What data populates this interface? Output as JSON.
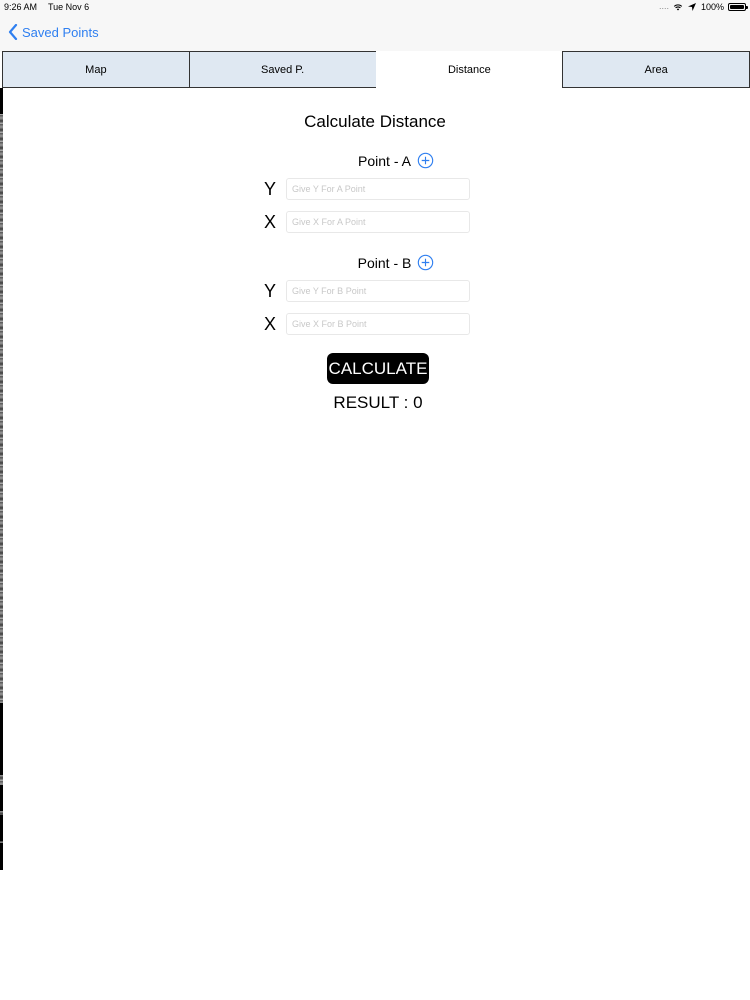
{
  "status_bar": {
    "time": "9:26 AM",
    "date": "Tue Nov 6",
    "signal_dots": "....",
    "battery_percent": "100%"
  },
  "nav": {
    "back_label": "Saved Points",
    "accent_color": "#2f7ff0"
  },
  "tabs": [
    {
      "label": "Map",
      "active": false
    },
    {
      "label": "Saved P.",
      "active": false
    },
    {
      "label": "Distance",
      "active": true
    },
    {
      "label": "Area",
      "active": false
    }
  ],
  "main": {
    "title": "Calculate Distance",
    "point_a": {
      "label": "Point - A",
      "y_label": "Y",
      "x_label": "X",
      "y_placeholder": "Give Y For A Point",
      "x_placeholder": "Give X For A Point",
      "y_value": "",
      "x_value": ""
    },
    "point_b": {
      "label": "Point - B",
      "y_label": "Y",
      "x_label": "X",
      "y_placeholder": "Give Y For B Point",
      "x_placeholder": "Give X For B Point",
      "y_value": "",
      "x_value": ""
    },
    "calculate_label": "CALCULATE",
    "result_text": "RESULT : 0"
  }
}
